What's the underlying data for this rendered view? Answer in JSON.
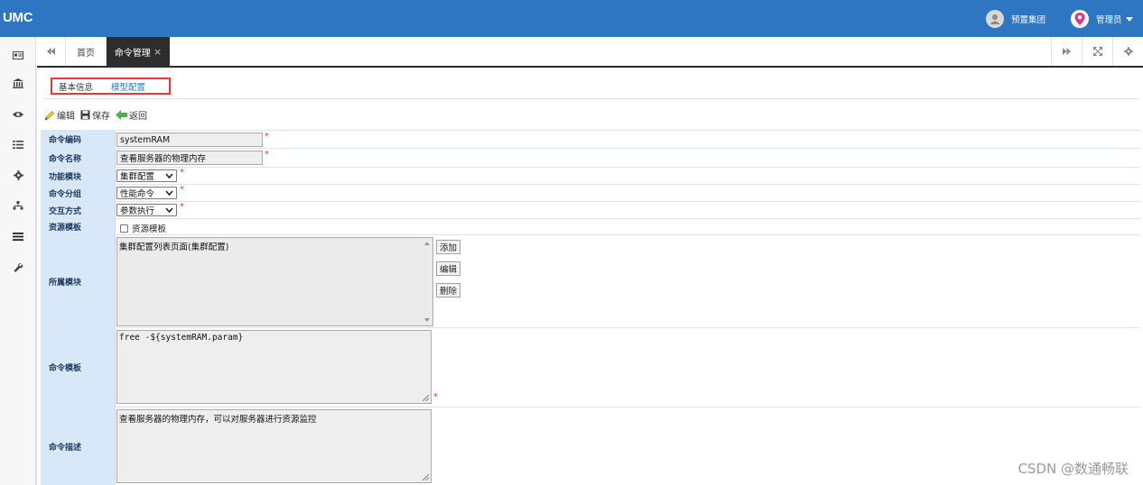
{
  "app": {
    "logo": "UMC"
  },
  "header": {
    "group_label": "预置集团",
    "user_label": "管理员"
  },
  "sidebar": {
    "items": [
      {
        "icon": "id-card-icon"
      },
      {
        "icon": "bank-icon"
      },
      {
        "icon": "eye-icon"
      },
      {
        "icon": "list-icon"
      },
      {
        "icon": "gear-icon"
      },
      {
        "icon": "sitemap-icon"
      },
      {
        "icon": "menu-icon"
      },
      {
        "icon": "wrench-icon"
      }
    ]
  },
  "tabs": {
    "home_label": "首页",
    "active_label": "命令管理",
    "close_glyph": "×"
  },
  "subtabs": {
    "basic": "基本信息",
    "model": "模型配置"
  },
  "toolbar": {
    "edit": "编辑",
    "save": "保存",
    "back": "返回"
  },
  "form": {
    "code_label": "命令编码",
    "code_value": "systemRAM",
    "name_label": "命令名称",
    "name_value": "查看服务器的物理内存",
    "module_label": "功能模块",
    "module_value": "集群配置",
    "group_label": "命令分组",
    "group_value": "性能命令",
    "interact_label": "交互方式",
    "interact_value": "参数执行",
    "resource_label": "资源模板",
    "resource_checkbox_label": "资源模板",
    "owner_label": "所属模块",
    "owner_items": [
      "集群配置列表页面(集群配置)"
    ],
    "add_button": "添加",
    "edit_button": "编辑",
    "delete_button": "删除",
    "template_label": "命令模板",
    "template_value": "free -${systemRAM.param}",
    "desc_label": "命令描述",
    "desc_value": "查看服务器的物理内存，可以对服务器进行资源监控",
    "required_mark": "*"
  },
  "watermark": "CSDN @数通畅联",
  "colors": {
    "topbar": "#2f76c2",
    "label_bg": "#d9e8f8",
    "required": "#e53935",
    "active_tab": "#2d2d2d"
  }
}
